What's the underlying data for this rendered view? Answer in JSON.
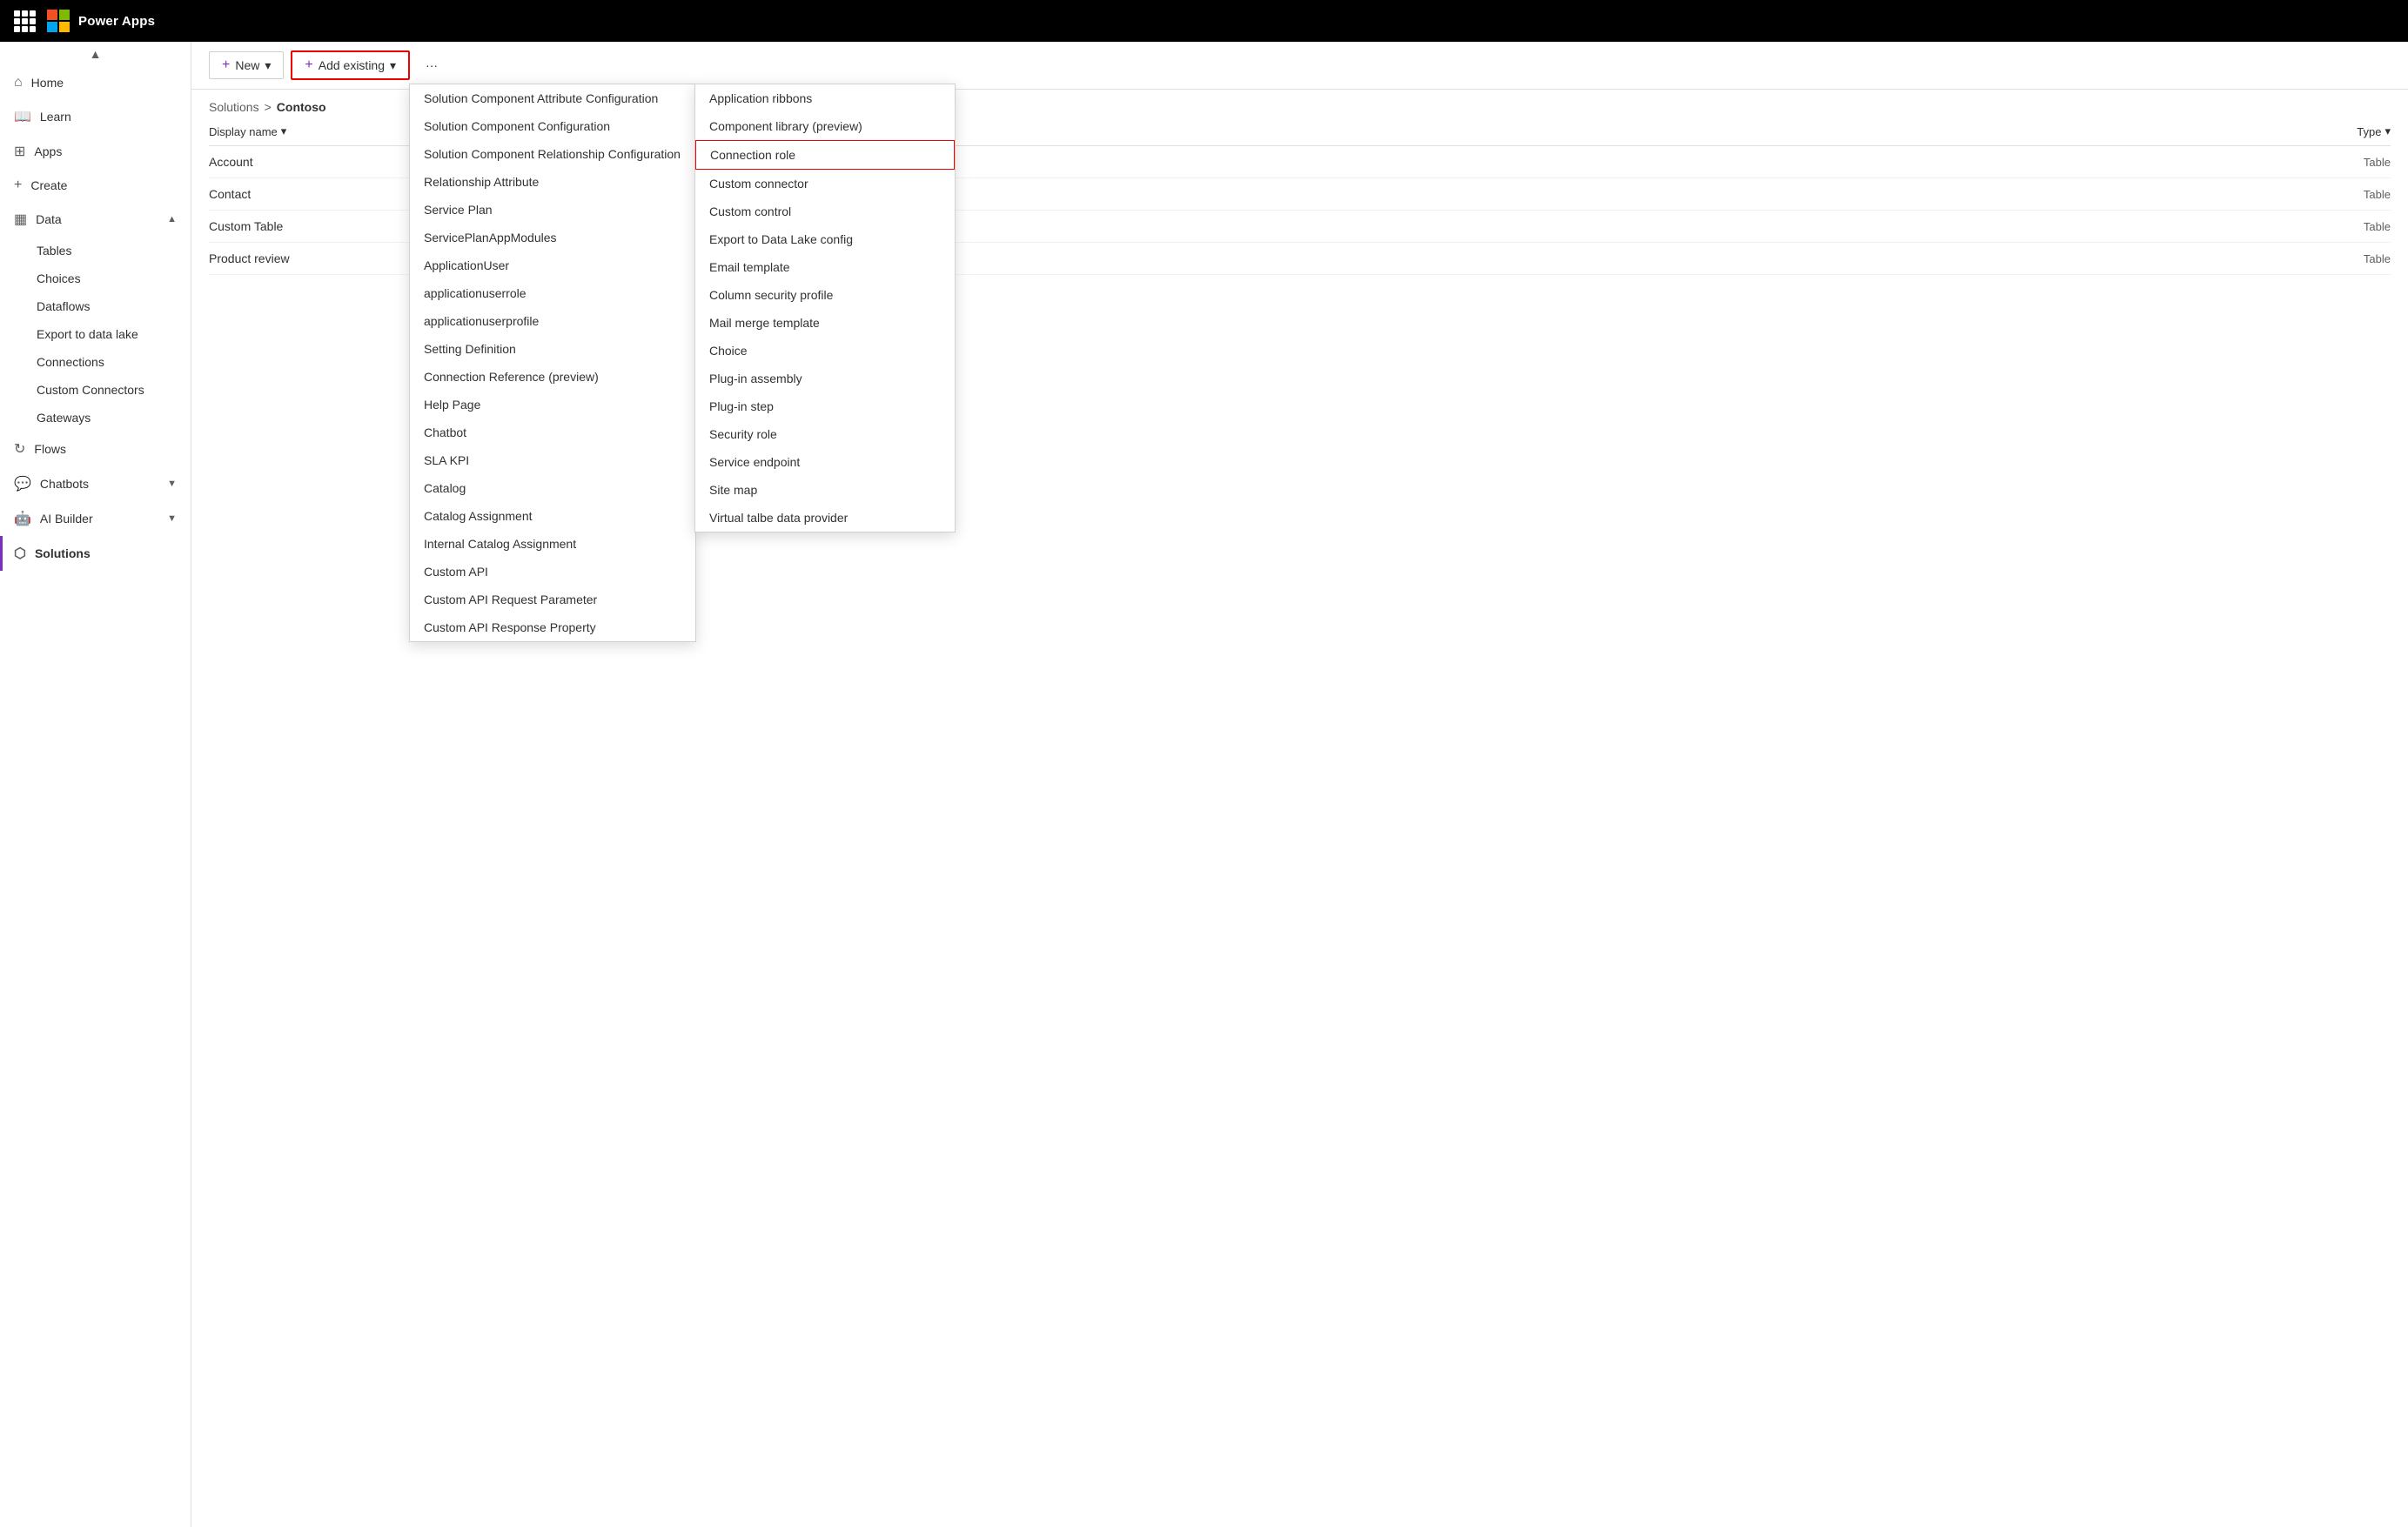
{
  "topbar": {
    "app_name": "Power Apps"
  },
  "sidebar": {
    "scroll_up": "▲",
    "items": [
      {
        "id": "home",
        "label": "Home",
        "icon": "⌂",
        "active": false
      },
      {
        "id": "learn",
        "label": "Learn",
        "icon": "📖",
        "active": false
      },
      {
        "id": "apps",
        "label": "Apps",
        "icon": "⊞",
        "active": false
      },
      {
        "id": "create",
        "label": "Create",
        "icon": "+",
        "active": false
      },
      {
        "id": "data",
        "label": "Data",
        "icon": "▦",
        "active": false,
        "expanded": true
      },
      {
        "id": "tables",
        "label": "Tables",
        "sub": true
      },
      {
        "id": "choices",
        "label": "Choices",
        "sub": true
      },
      {
        "id": "dataflows",
        "label": "Dataflows",
        "sub": true
      },
      {
        "id": "export-to-data-lake",
        "label": "Export to data lake",
        "sub": true
      },
      {
        "id": "connections",
        "label": "Connections",
        "sub": true
      },
      {
        "id": "custom-connectors",
        "label": "Custom Connectors",
        "sub": true
      },
      {
        "id": "gateways",
        "label": "Gateways",
        "sub": true
      },
      {
        "id": "flows",
        "label": "Flows",
        "icon": "↻",
        "active": false
      },
      {
        "id": "chatbots",
        "label": "Chatbots",
        "icon": "💬",
        "active": false,
        "hasChevron": true
      },
      {
        "id": "ai-builder",
        "label": "AI Builder",
        "icon": "🤖",
        "active": false,
        "hasChevron": true
      },
      {
        "id": "solutions",
        "label": "Solutions",
        "icon": "⬡",
        "active": true
      }
    ]
  },
  "toolbar": {
    "new_label": "New",
    "add_existing_label": "Add existing",
    "more_label": "···"
  },
  "breadcrumb": {
    "solutions_label": "Solutions",
    "separator": ">",
    "current": "Contoso"
  },
  "table": {
    "col_display_name": "Display name",
    "col_type": "Type",
    "rows": [
      {
        "name": "Account",
        "type": "Table"
      },
      {
        "name": "Contact",
        "type": "Table"
      },
      {
        "name": "Custom Table",
        "type": "Table"
      },
      {
        "name": "Product review",
        "type": "Table"
      }
    ]
  },
  "dropdown_left": {
    "items": [
      "Solution Component Attribute Configuration",
      "Solution Component Configuration",
      "Solution Component Relationship Configuration",
      "Relationship Attribute",
      "Service Plan",
      "ServicePlanAppModules",
      "ApplicationUser",
      "applicationuserrole",
      "applicationuserprofile",
      "Setting Definition",
      "Connection Reference (preview)",
      "Help Page",
      "Chatbot",
      "SLA KPI",
      "Catalog",
      "Catalog Assignment",
      "Internal Catalog Assignment",
      "Custom API",
      "Custom API Request Parameter",
      "Custom API Response Property"
    ]
  },
  "dropdown_right": {
    "items": [
      "Application ribbons",
      "Component library (preview)",
      "Connection role",
      "Custom connector",
      "Custom control",
      "Export to Data Lake config",
      "Email template",
      "Column security profile",
      "Mail merge template",
      "Choice",
      "Plug-in assembly",
      "Plug-in step",
      "Security role",
      "Service endpoint",
      "Site map",
      "Virtual talbe data provider"
    ],
    "highlighted": "Connection role"
  }
}
